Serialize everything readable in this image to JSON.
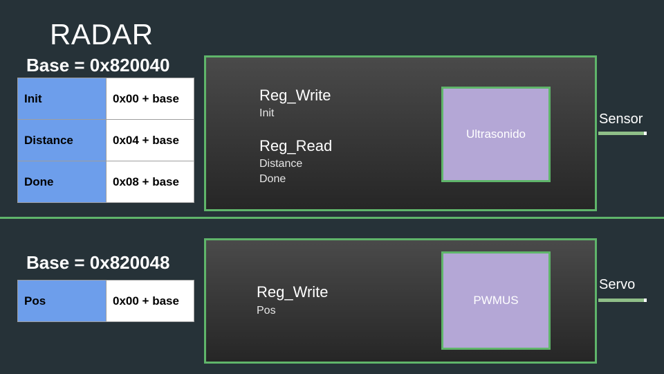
{
  "title": "RADAR",
  "radar": {
    "base_label": "Base = 0x820040",
    "registers": [
      {
        "name": "Init",
        "address": "0x00 + base"
      },
      {
        "name": "Distance",
        "address": "0x04 + base"
      },
      {
        "name": "Done",
        "address": "0x08 + base"
      }
    ],
    "module": {
      "write_heading": "Reg_Write",
      "write_items": [
        "Init"
      ],
      "read_heading": "Reg_Read",
      "read_items": [
        "Distance",
        "Done"
      ],
      "ip_label": "Ultrasonido",
      "port_label": "Sensor"
    }
  },
  "servo": {
    "base_label": "Base = 0x820048",
    "registers": [
      {
        "name": "Pos",
        "address": "0x00 + base"
      }
    ],
    "module": {
      "write_heading": "Reg_Write",
      "write_items": [
        "Pos"
      ],
      "ip_label": "PWMUS",
      "port_label": "Servo"
    }
  },
  "colors": {
    "background": "#263238",
    "accent_green": "#5fb56a",
    "register_name_fill": "#6d9eeb",
    "ip_block_fill": "#b4a7d6"
  }
}
